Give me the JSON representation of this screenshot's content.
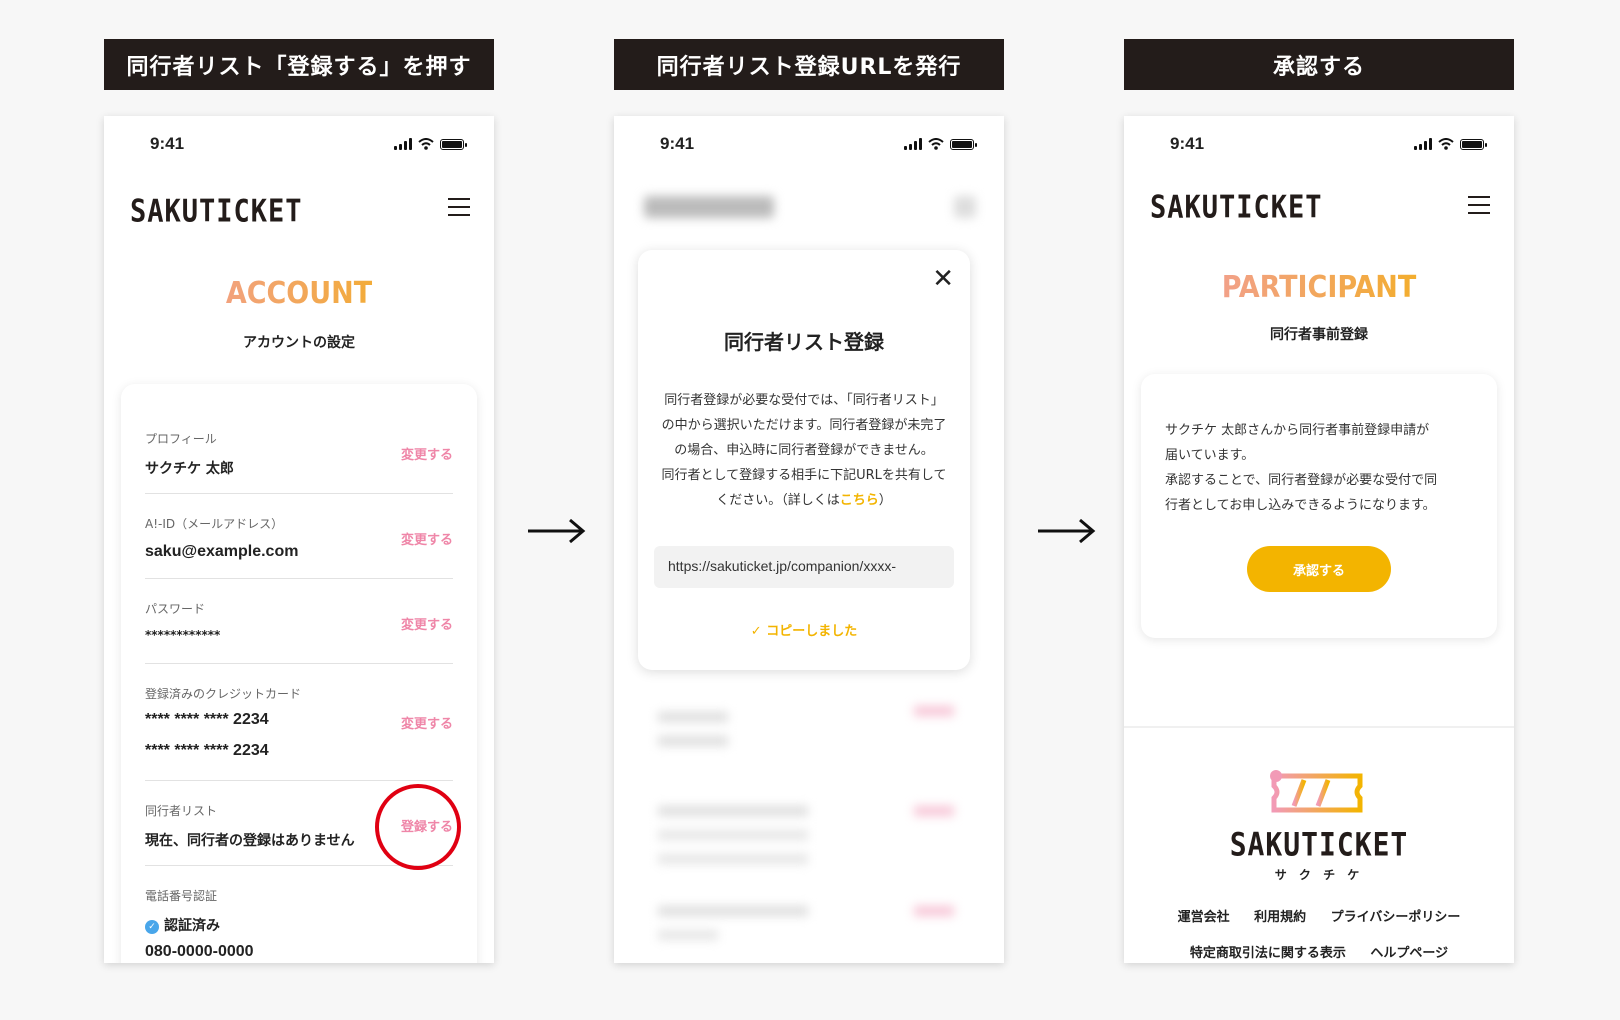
{
  "steps": [
    {
      "label": "同行者リスト「登録する」を押す"
    },
    {
      "label": "同行者リスト登録URLを発行"
    },
    {
      "label": "承認する"
    }
  ],
  "status": {
    "time": "9:41"
  },
  "brand": {
    "logo": "SAKUTICKET",
    "logo_kana": "サ ク チ ケ"
  },
  "account": {
    "title": "ACCOUNT",
    "subtitle": "アカウントの設定",
    "rows": [
      {
        "label": "プロフィール",
        "value": "サクチケ 太郎",
        "action": "変更する"
      },
      {
        "label": "A!-ID（メールアドレス）",
        "value": "saku@example.com",
        "action": "変更する"
      },
      {
        "label": "パスワード",
        "value": "************",
        "action": "変更する"
      },
      {
        "label": "登録済みのクレジットカード",
        "value": "**** **** **** 2234",
        "value2": "**** **** **** 2234",
        "action": "変更する"
      },
      {
        "label": "同行者リスト",
        "value": "現在、同行者の登録はありません",
        "action": "登録する"
      },
      {
        "label": "電話番号認証",
        "value": "認証済み",
        "value2": "080-0000-0000"
      }
    ]
  },
  "modal": {
    "close": "✕",
    "title": "同行者リスト登録",
    "body_lines": [
      "同行者登録が必要な受付では、「同行者リスト」",
      "の中から選択いただけます。同行者登録が未完了",
      "の場合、申込時に同行者登録ができません。",
      "同行者として登録する相手に下記URLを共有して"
    ],
    "body_last": "ください。（詳しくは",
    "body_link": "こちら",
    "body_close": "）",
    "url": "https://sakuticket.jp/companion/xxxx-",
    "copied": "✓ コピーしました"
  },
  "participant": {
    "title": "PARTICIPANT",
    "subtitle": "同行者事前登録",
    "text_lines": [
      "サクチケ 太郎さんから同行者事前登録申請が",
      "届いています。",
      "承認することで、同行者登録が必要な受付で同",
      "行者としてお申し込みできるようになります。"
    ],
    "button": "承認する"
  },
  "footer": {
    "links_row1": [
      "運営会社",
      "利用規約",
      "プライバシーポリシー"
    ],
    "links_row2": [
      "特定商取引法に関する表示",
      "ヘルプページ"
    ]
  },
  "colors": {
    "accent_pink": "#ef86a8",
    "accent_yellow": "#f3b400",
    "dark": "#231c1a",
    "alert_red": "#e00012"
  }
}
